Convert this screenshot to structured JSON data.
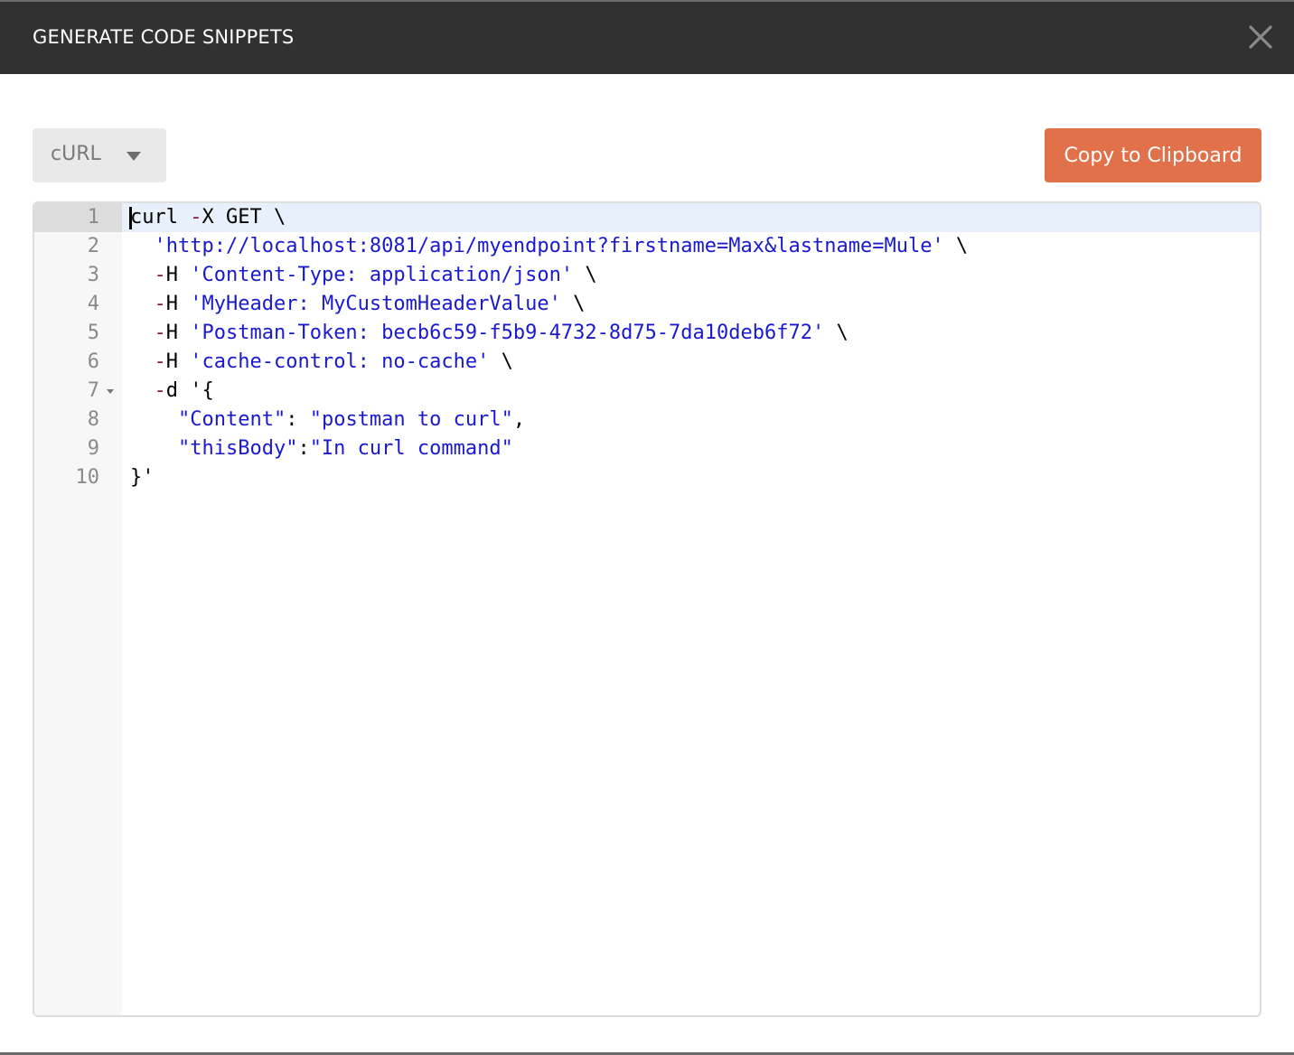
{
  "dialog": {
    "title": "GENERATE CODE SNIPPETS",
    "close_icon": "close-icon"
  },
  "toolbar": {
    "language_selected": "cURL",
    "language_caret_icon": "chevron-down-icon",
    "copy_label": "Copy to Clipboard"
  },
  "colors": {
    "header_bg": "#313131",
    "copy_button_bg": "#e0714a",
    "string_color": "#1a1acc",
    "operator_color": "#8a1a4a",
    "active_line_bg": "#e8f0fc"
  },
  "editor": {
    "active_line": 1,
    "lines": [
      {
        "number": "1",
        "indent": "",
        "tokens": [
          {
            "t": "plain",
            "v": "curl "
          },
          {
            "t": "op",
            "v": "-"
          },
          {
            "t": "plain",
            "v": "X GET \\"
          }
        ]
      },
      {
        "number": "2",
        "indent": "  ",
        "tokens": [
          {
            "t": "str",
            "v": "'http://localhost:8081/api/myendpoint?firstname=Max&lastname=Mule'"
          },
          {
            "t": "plain",
            "v": " \\"
          }
        ]
      },
      {
        "number": "3",
        "indent": "  ",
        "tokens": [
          {
            "t": "op",
            "v": "-"
          },
          {
            "t": "plain",
            "v": "H "
          },
          {
            "t": "str",
            "v": "'Content-Type: application/json'"
          },
          {
            "t": "plain",
            "v": " \\"
          }
        ]
      },
      {
        "number": "4",
        "indent": "  ",
        "tokens": [
          {
            "t": "op",
            "v": "-"
          },
          {
            "t": "plain",
            "v": "H "
          },
          {
            "t": "str",
            "v": "'MyHeader: MyCustomHeaderValue'"
          },
          {
            "t": "plain",
            "v": " \\"
          }
        ]
      },
      {
        "number": "5",
        "indent": "  ",
        "tokens": [
          {
            "t": "op",
            "v": "-"
          },
          {
            "t": "plain",
            "v": "H "
          },
          {
            "t": "str",
            "v": "'Postman-Token: becb6c59-f5b9-4732-8d75-7da10deb6f72'"
          },
          {
            "t": "plain",
            "v": " \\"
          }
        ]
      },
      {
        "number": "6",
        "indent": "  ",
        "tokens": [
          {
            "t": "op",
            "v": "-"
          },
          {
            "t": "plain",
            "v": "H "
          },
          {
            "t": "str",
            "v": "'cache-control: no-cache'"
          },
          {
            "t": "plain",
            "v": " \\"
          }
        ]
      },
      {
        "number": "7",
        "indent": "  ",
        "fold": true,
        "tokens": [
          {
            "t": "op",
            "v": "-"
          },
          {
            "t": "plain",
            "v": "d '{"
          }
        ]
      },
      {
        "number": "8",
        "indent": "    ",
        "tokens": [
          {
            "t": "str",
            "v": "\"Content\""
          },
          {
            "t": "plain",
            "v": ": "
          },
          {
            "t": "str",
            "v": "\"postman to curl\""
          },
          {
            "t": "plain",
            "v": ","
          }
        ]
      },
      {
        "number": "9",
        "indent": "    ",
        "tokens": [
          {
            "t": "str",
            "v": "\"thisBody\""
          },
          {
            "t": "plain",
            "v": ":"
          },
          {
            "t": "str",
            "v": "\"In curl command\""
          }
        ]
      },
      {
        "number": "10",
        "indent": "",
        "tokens": [
          {
            "t": "plain",
            "v": "}'"
          }
        ]
      }
    ]
  }
}
